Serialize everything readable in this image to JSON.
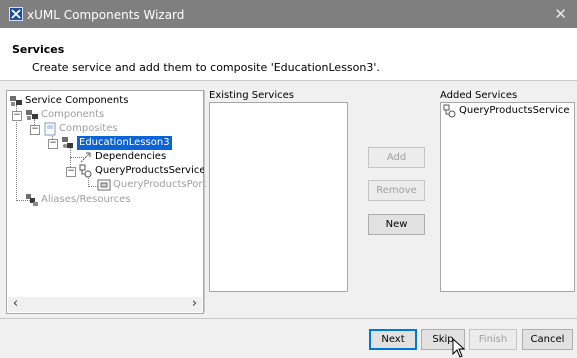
{
  "window": {
    "title": "xUML Components Wizard",
    "close_glyph": "✕",
    "app_icon": "wizard-app-icon"
  },
  "header": {
    "title": "Services",
    "description": "Create service and add them to composite 'EducationLesson3'."
  },
  "tree": {
    "root": {
      "label": "Service Components",
      "icon": "package-icon"
    },
    "components": {
      "label": "Components",
      "icon": "components-icon",
      "expander": "−"
    },
    "composites": {
      "label": "Composites",
      "icon": "composites-icon",
      "expander": "−"
    },
    "education": {
      "label": "EducationLesson3",
      "icon": "composite-icon",
      "expander": "−",
      "selected": true
    },
    "dependencies": {
      "label": "Dependencies",
      "icon": "dependency-icon"
    },
    "query_service": {
      "label": "QueryProductsService",
      "icon": "service-icon",
      "expander": "−"
    },
    "query_port": {
      "label": "QueryProductsPort",
      "icon": "port-icon"
    },
    "aliases": {
      "label": "Aliases/Resources",
      "icon": "aliases-icon"
    },
    "scroll_left": "‹",
    "scroll_right": "›"
  },
  "existing_services": {
    "label": "Existing Services",
    "items": []
  },
  "added_services": {
    "label": "Added Services",
    "items": [
      {
        "label": "QueryProductsService",
        "icon": "service-icon"
      }
    ]
  },
  "buttons": {
    "add": "Add",
    "remove": "Remove",
    "new": "New",
    "next": "Next",
    "skip": "Skip",
    "finish": "Finish",
    "cancel": "Cancel"
  },
  "colors": {
    "titlebar": "#7f7f7f",
    "selection": "#0a64d6",
    "disabled_text": "#a0a0a0",
    "focus_border": "#0078d7"
  }
}
